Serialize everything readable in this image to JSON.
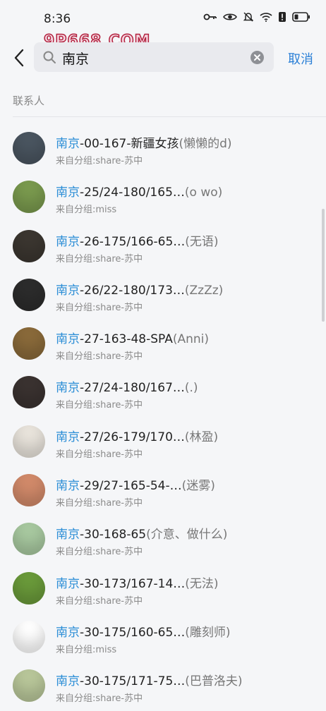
{
  "status": {
    "time": "8:36",
    "watermark": "9P668.COM"
  },
  "header": {
    "search_value": "南京",
    "cancel_label": "取消"
  },
  "section": {
    "title": "联系人"
  },
  "contacts": [
    {
      "highlight": "南京",
      "name": "-00-167-新疆女孩",
      "note": "(懒懒的d)",
      "group": "来自分组:share-苏中",
      "avatar_color": "#4a5560"
    },
    {
      "highlight": "南京",
      "name": "-25/24-180/165…",
      "note": "(o wo)",
      "group": "来自分组:miss",
      "avatar_color": "#7a9a4e"
    },
    {
      "highlight": "南京",
      "name": "-26-175/166-65…",
      "note": "(无语)",
      "group": "来自分组:share-苏中",
      "avatar_color": "#3b3630"
    },
    {
      "highlight": "南京",
      "name": "-26/22-180/173…",
      "note": "(ZzZz)",
      "group": "来自分组:share-苏中",
      "avatar_color": "#2c2c2c"
    },
    {
      "highlight": "南京",
      "name": "-27-163-48-SPA",
      "note": "(Anni)",
      "group": "来自分组:share-苏中",
      "avatar_color": "#8a6a3a"
    },
    {
      "highlight": "南京",
      "name": "-27/24-180/167…",
      "note": "(.)",
      "group": "来自分组:share-苏中",
      "avatar_color": "#3a3230"
    },
    {
      "highlight": "南京",
      "name": "-27/26-179/170…",
      "note": "(林盈)",
      "group": "来自分组:share-苏中",
      "avatar_color": "#e9e4dc"
    },
    {
      "highlight": "南京",
      "name": "-29/27-165-54-…",
      "note": "(迷雾)",
      "group": "来自分组:share-苏中",
      "avatar_color": "#d28a6a"
    },
    {
      "highlight": "南京",
      "name": "-30-168-65",
      "note": "(介意、做什么)",
      "group": "来自分组:share-苏中",
      "avatar_color": "#a8c9a0"
    },
    {
      "highlight": "南京",
      "name": "-30-173/167-14…",
      "note": "(无法)",
      "group": "来自分组:share-苏中",
      "avatar_color": "#6a9a3a"
    },
    {
      "highlight": "南京",
      "name": "-30-175/160-65…",
      "note": "(雕刻师)",
      "group": "来自分组:miss",
      "avatar_color": "#ffffff"
    },
    {
      "highlight": "南京",
      "name": "-30-175/171-75…",
      "note": "(巴普洛夫)",
      "group": "来自分组:share-苏中",
      "avatar_color": "#b9c79a"
    }
  ]
}
